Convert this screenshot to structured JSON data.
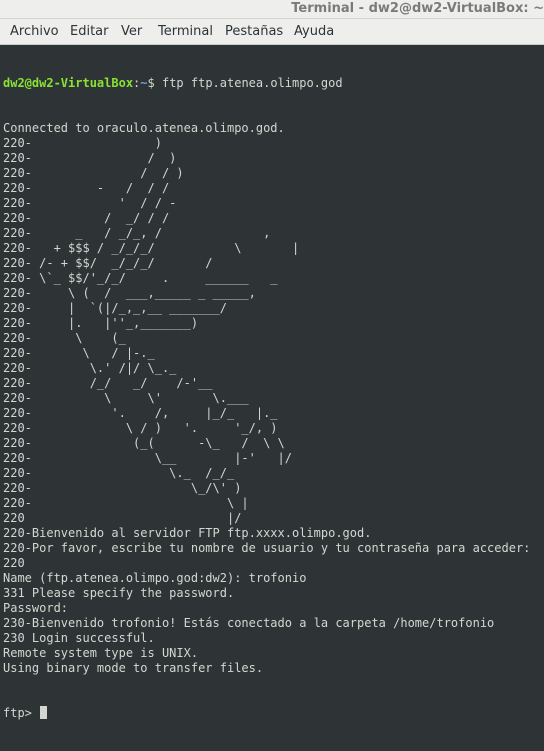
{
  "window": {
    "title": "Terminal - dw2@dw2-VirtualBox: ~"
  },
  "menu": [
    "Archivo",
    "Editar",
    "Ver",
    "Terminal",
    "Pestañas",
    "Ayuda"
  ],
  "colors": {
    "background": "#2e3436",
    "foreground": "#d3d7cf",
    "user": "#8ae234",
    "path": "#729fcf"
  },
  "prompt": {
    "user_host": "dw2@dw2-VirtualBox",
    "sep": ":",
    "path": "~",
    "symbol": "$ ",
    "command": "ftp ftp.atenea.olimpo.god"
  },
  "output": [
    "Connected to oraculo.atenea.olimpo.god.",
    "220-                 )",
    "220-                /  )",
    "220-               /  / )",
    "220-         -   /  / /",
    "220-            '  / / -",
    "220-          /  _/ / /",
    "220-      _   / _/_, /              ,",
    "220-   + $$$ / _/_/_/           \\       |",
    "220- /- + $$/  _/_/_/       /",
    "220- \\`_ $$/'_/_/     .     ______   _",
    "220-     \\ (  /  ___,_____ _ _____,",
    "220-     |  `(|/_,_,__ _______/",
    "220-     |.   |''_,_______)",
    "220-      \\    (_",
    "220-       \\   / |-._",
    "220-        \\.' /|/ \\_._",
    "220-        /_/   _/    /-'__",
    "220-          \\     \\'       \\.___",
    "220-           '.    /,     |_/_   |._",
    "220-             \\ / )   '.     '_/, )",
    "220-              (_(      -\\_   /  \\ \\",
    "220-                 \\__        |-'   |/",
    "220-                   \\._  /_/_",
    "220-                      \\_/\\' )",
    "220-                           \\ |",
    "220                            |/",
    "220-Bienvenido al servidor FTP ftp.xxxx.olimpo.god.",
    "220-Por favor, escribe tu nombre de usuario y tu contraseña para acceder:",
    "220",
    "Name (ftp.atenea.olimpo.god:dw2): trofonio",
    "331 Please specify the password.",
    "Password:",
    "230-Bienvenido trofonio! Estás conectado a la carpeta /home/trofonio",
    "230 Login successful.",
    "Remote system type is UNIX.",
    "Using binary mode to transfer files."
  ],
  "ftp_prompt": "ftp> "
}
